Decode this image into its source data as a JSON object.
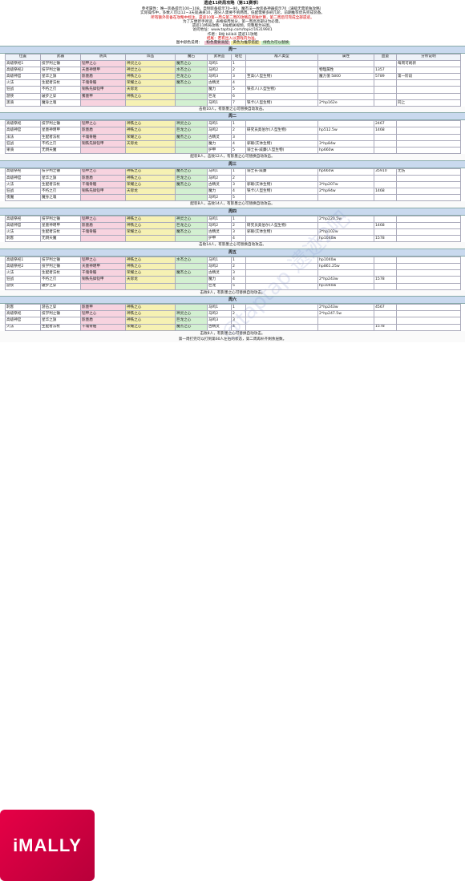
{
  "intro": {
    "title": "遗迹11终局攻略（第11赛季）",
    "lines": [
      "参考属性：唯一装备提示100~108，自制装备提示70~90，魔杰法一枚装备神器提示70（满级无需单独攻略）",
      "实际操作中，多数人可以12~3天就通关10，部分人需要不到两周。低配需要多刷几轮，前期推荐优先完成装备。",
      "所有额外装备在攻略中标注，遗迹10第一周与第二周的攻略应单独计算，第二周后可完成全部遗迹。",
      "为了方便新手阅读，表格按周划分，第一周高亮部分为必需。",
      "遗迹11终局攻略：B站相关视频，完整版为长图。",
      "访问地址：www.taptap.com/topic/16319941",
      "作者：B站 bilibili 遗迹11攻略",
      "结尾：若有出入以游戏内为准。"
    ],
    "legend_label": "图中颜色说明：",
    "legend": [
      "粉色需要高配",
      "黄色为推荐搭配",
      "绿色为可以替换"
    ]
  },
  "columns": [
    "位置",
    "武器",
    "防具",
    "饰品",
    "魔石",
    "武将品",
    "站位",
    "敌人类型",
    "属性",
    "血量",
    "分析说明"
  ],
  "weeks": [
    {
      "title": "周一",
      "rows": [
        {
          "pos": "高级祭祀1",
          "weapon": "技学判之锤",
          "armor": "铠甲之心",
          "acc": "神灵之心",
          "stone": "魔杰之心",
          "item": "马鸣1",
          "slot": "1",
          "enemy": "",
          "attr": "",
          "hp": "",
          "note": "每周可刷新"
        },
        {
          "pos": "高级祭祀2",
          "weapon": "技学判之锤",
          "armor": "天墨神明甲",
          "acc": "神灵之心",
          "stone": "水杰之心",
          "item": "马鸣2",
          "slot": "2",
          "enemy": "",
          "attr": "物理属性",
          "hp": "1357",
          "note": ""
        },
        {
          "pos": "高级神官",
          "weapon": "星华之旗",
          "armor": "影墨盾",
          "acc": "神铁之心",
          "stone": "巨龙之心",
          "item": "马鸣3",
          "slot": "3",
          "enemy": "至高(人型生物)",
          "attr": "魔力值 5800",
          "hp": "5789",
          "note": "第一阶段"
        },
        {
          "pos": "火法",
          "weapon": "生配者法杖",
          "armor": "千魂骨骼",
          "acc": "荣耀之心",
          "stone": "魔杰之心",
          "item": "古精灵",
          "slot": "4",
          "enemy": "",
          "attr": "",
          "hp": "",
          "note": ""
        },
        {
          "pos": "狂战",
          "weapon": "不朽之刃",
          "armor": "铜铁先锋铠甲",
          "acc": "天际龙",
          "stone": "",
          "item": "魔力",
          "slot": "5",
          "enemy": "铁衣人(人型生物)",
          "attr": "",
          "hp": "",
          "note": ""
        },
        {
          "pos": "游侠",
          "weapon": "破步之穿",
          "armor": "雾墨甲",
          "acc": "神铁之心",
          "stone": "",
          "item": "巨龙",
          "slot": "6",
          "enemy": "",
          "attr": "",
          "hp": "",
          "note": ""
        },
        {
          "pos": "黑骑",
          "weapon": "魔身之魂",
          "armor": "",
          "acc": "",
          "stone": "",
          "item": "马鸣1",
          "slot": "7",
          "enemy": "铁卡(人型生物)",
          "attr": "2*hp162e",
          "hp": "",
          "note": "同上"
        }
      ],
      "summary": "击败10人，有影墨之心可替换自动攻击。"
    },
    {
      "title": "周二",
      "rows": [
        {
          "pos": "高级祭祀",
          "weapon": "技学判之锤",
          "armor": "铠甲之心",
          "acc": "神铁之心",
          "stone": "神灵之心",
          "item": "马鸣1",
          "slot": "1",
          "enemy": "",
          "attr": "",
          "hp": "2467",
          "note": ""
        },
        {
          "pos": "高级神官",
          "weapon": "星墨神明甲",
          "armor": "影墨盾",
          "acc": "神铁之心",
          "stone": "巨龙之心",
          "item": "马鸣2",
          "slot": "2",
          "enemy": "研究员奥伯尔(人型生物)",
          "attr": "hp512.5w",
          "hp": "1468",
          "note": ""
        },
        {
          "pos": "法法",
          "weapon": "生配者法杖",
          "armor": "千魂骨骼",
          "acc": "荣耀之心",
          "stone": "魔杰之心",
          "item": "古精灵",
          "slot": "3",
          "enemy": "",
          "attr": "",
          "hp": "",
          "note": ""
        },
        {
          "pos": "狂战",
          "weapon": "不朽之刃",
          "armor": "铜铁先锋铠甲",
          "acc": "天际龙",
          "stone": "",
          "item": "魔力",
          "slot": "4",
          "enemy": "邪眼(实体生物)",
          "attr": "3*hp84w",
          "hp": "",
          "note": ""
        },
        {
          "pos": "果骑",
          "weapon": "无倒天魔",
          "armor": "",
          "acc": "",
          "stone": "",
          "item": "护甲",
          "slot": "5",
          "enemy": "骑士长·威廉(人型生物)",
          "attr": "hp660w",
          "hp": "",
          "note": ""
        }
      ],
      "summary": "配装B人，击败12人，有影墨之心可替换自动攻击。"
    },
    {
      "title": "周三",
      "rows": [
        {
          "pos": "高级祭祀",
          "weapon": "技学判之锤",
          "armor": "铠甲之心",
          "acc": "神铁之心",
          "stone": "魔杰之心",
          "item": "马鸣1",
          "slot": "1",
          "enemy": "骑士长·威廉",
          "attr": "hp660w",
          "hp": "35910",
          "note": "无伤"
        },
        {
          "pos": "高级神官",
          "weapon": "星华之旗",
          "armor": "影墨盾",
          "acc": "神铁之心",
          "stone": "巨龙之心",
          "item": "马鸣2",
          "slot": "2",
          "enemy": "",
          "attr": "",
          "hp": "",
          "note": ""
        },
        {
          "pos": "火法",
          "weapon": "生配者法杖",
          "armor": "千魂骨骼",
          "acc": "荣耀之心",
          "stone": "魔杰之心",
          "item": "古精灵",
          "slot": "3",
          "enemy": "邪眼(实体生物)",
          "attr": "3*hp207w",
          "hp": "",
          "note": ""
        },
        {
          "pos": "狂战",
          "weapon": "不朽之刃",
          "armor": "铜铁先锋铠甲",
          "acc": "天际龙",
          "stone": "",
          "item": "魔力",
          "slot": "4",
          "enemy": "铁卡(人型生物)",
          "attr": "2*hp94w",
          "hp": "1468",
          "note": ""
        },
        {
          "pos": "夜魔",
          "weapon": "魔身之魂",
          "armor": "",
          "acc": "",
          "stone": "",
          "item": "马鸣2",
          "slot": "5",
          "enemy": "",
          "attr": "",
          "hp": "",
          "note": ""
        }
      ],
      "summary": "配装B人，击败14人，有影墨之心可替换自动攻击。"
    },
    {
      "title": "周四",
      "rows": [
        {
          "pos": "高级祭祀",
          "weapon": "技学判之锤",
          "armor": "铠甲之心",
          "acc": "神铁之心",
          "stone": "神灵之心",
          "item": "马鸣1",
          "slot": "1",
          "enemy": "",
          "attr": "2*hp220.5w",
          "hp": "",
          "note": ""
        },
        {
          "pos": "高级神官",
          "weapon": "星墨神明甲",
          "armor": "影墨盾",
          "acc": "神铁之心",
          "stone": "巨龙之心",
          "item": "马鸣2",
          "slot": "2",
          "enemy": "研究员奥伯尔(人型生物)",
          "attr": "",
          "hp": "1468",
          "note": ""
        },
        {
          "pos": "火法",
          "weapon": "生配者法杖",
          "armor": "千魂骨骼",
          "acc": "荣耀之心",
          "stone": "魔杰之心",
          "item": "古精灵",
          "slot": "3",
          "enemy": "邪眼(实体生物)",
          "attr": "3*hp102w",
          "hp": "",
          "note": ""
        },
        {
          "pos": "刺客",
          "weapon": "无倒天魔",
          "armor": "",
          "acc": "",
          "stone": "",
          "item": "护甲",
          "slot": "4",
          "enemy": "",
          "attr": "hp1040w",
          "hp": "1578",
          "note": ""
        }
      ],
      "summary": "击败14人，有影墨之心可替换自动攻击。"
    },
    {
      "title": "周五",
      "rows": [
        {
          "pos": "高级祭祀1",
          "weapon": "技学判之锤",
          "armor": "铠甲之心",
          "acc": "神铁之心",
          "stone": "水杰之心",
          "item": "马鸣1",
          "slot": "1",
          "enemy": "",
          "attr": "hp1040w",
          "hp": "",
          "note": ""
        },
        {
          "pos": "高级祭祀2",
          "weapon": "技学判之锤",
          "armor": "天墨神明甲",
          "acc": "神铁之心",
          "stone": "",
          "item": "马鸣2",
          "slot": "2",
          "enemy": "",
          "attr": "hp861.25w",
          "hp": "",
          "note": ""
        },
        {
          "pos": "火法",
          "weapon": "生配者法杖",
          "armor": "千魂骨骼",
          "acc": "荣耀之心",
          "stone": "魔杰之心",
          "item": "古精灵",
          "slot": "3",
          "enemy": "",
          "attr": "",
          "hp": "",
          "note": ""
        },
        {
          "pos": "狂战",
          "weapon": "不朽之刃",
          "armor": "铜铁先锋铠甲",
          "acc": "天际龙",
          "stone": "",
          "item": "魔力",
          "slot": "4",
          "enemy": "",
          "attr": "2*hp243w",
          "hp": "1578",
          "note": ""
        },
        {
          "pos": "游侠",
          "weapon": "破步之穿",
          "armor": "",
          "acc": "",
          "stone": "",
          "item": "巨龙",
          "slot": "5",
          "enemy": "",
          "attr": "hp1040w",
          "hp": "",
          "note": ""
        }
      ],
      "summary": "击败8人，有影墨之心可替换自动攻击。"
    },
    {
      "title": "周六",
      "rows": [
        {
          "pos": "刺客",
          "weapon": "游击之穿",
          "armor": "影墨甲",
          "acc": "神铁之心",
          "stone": "",
          "item": "马鸣1",
          "slot": "1",
          "enemy": "",
          "attr": "2*hp243w",
          "hp": "4567",
          "note": ""
        },
        {
          "pos": "高级祭祀",
          "weapon": "技学判之锤",
          "armor": "铠甲之心",
          "acc": "神铁之心",
          "stone": "神灵之心",
          "item": "马鸣2",
          "slot": "2",
          "enemy": "",
          "attr": "2*hp247.5w",
          "hp": "",
          "note": ""
        },
        {
          "pos": "高级神官",
          "weapon": "星华之旗",
          "armor": "影墨盾",
          "acc": "神铁之心",
          "stone": "巨龙之心",
          "item": "马鸣3",
          "slot": "3",
          "enemy": "",
          "attr": "",
          "hp": "",
          "note": ""
        },
        {
          "pos": "火法",
          "weapon": "生配者法杖",
          "armor": "千魂骨骼",
          "acc": "荣耀之心",
          "stone": "魔杰之心",
          "item": "古精灵",
          "slot": "4",
          "enemy": "",
          "attr": "",
          "hp": "1578",
          "note": ""
        }
      ],
      "summary": "击败8人，有影墨之心可替换自动攻击。"
    }
  ],
  "footer": "第一周打完可以打到第60人左右的状态，第二周再补齐剩余层数。",
  "logo_text": "iMALLY",
  "watermark": "@taptap 遗迹2吧"
}
